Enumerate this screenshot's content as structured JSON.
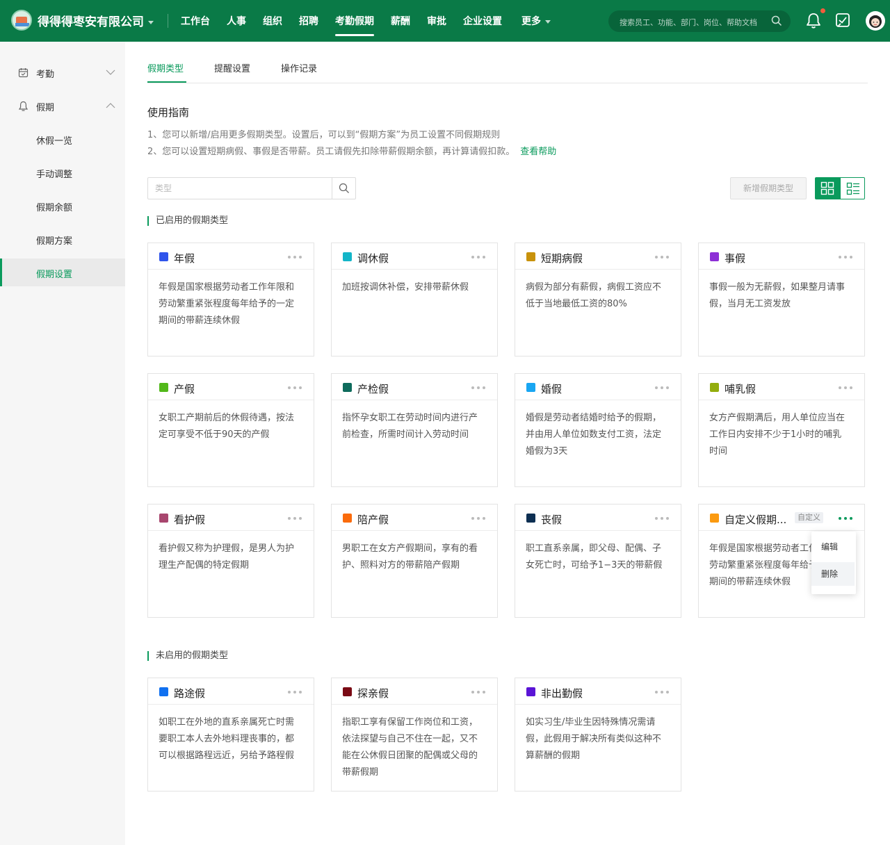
{
  "header": {
    "company": "得得得枣安有限公司",
    "nav": [
      "工作台",
      "人事",
      "组织",
      "招聘",
      "考勤假期",
      "薪酬",
      "审批",
      "企业设置",
      "更多"
    ],
    "active_nav": "考勤假期",
    "search_placeholder": "搜索员工、功能、部门、岗位、帮助文档",
    "notification_dot": true
  },
  "sidebar": {
    "groups": [
      {
        "label": "考勤",
        "icon": "calendar-icon",
        "expanded": false
      },
      {
        "label": "假期",
        "icon": "bell-icon",
        "expanded": true
      }
    ],
    "items": [
      "休假一览",
      "手动调整",
      "假期余额",
      "假期方案",
      "假期设置"
    ],
    "active": "假期设置"
  },
  "tabs": [
    "假期类型",
    "提醒设置",
    "操作记录"
  ],
  "active_tab": "假期类型",
  "guide": {
    "title": "使用指南",
    "line1": "1、您可以新增/启用更多假期类型。设置后，可以到“假期方案”为员工设置不同假期规则",
    "line2": "2、您可以设置短期病假、事假是否带薪。员工请假先扣除带薪假期余额，再计算请假扣款。",
    "help_link": "查看帮助"
  },
  "toolbar": {
    "type_placeholder": "类型",
    "add_button": "新增假期类型"
  },
  "enabled_title": "已启用的假期类型",
  "disabled_title": "未启用的假期类型",
  "enabled_types": [
    {
      "name": "年假",
      "color": "#2f54eb",
      "desc": "年假是国家根据劳动者工作年限和劳动繁重紧张程度每年给予的一定期间的带薪连续休假"
    },
    {
      "name": "调休假",
      "color": "#13b5c8",
      "desc": "加班按调休补偿，安排带薪休假"
    },
    {
      "name": "短期病假",
      "color": "#c8920b",
      "desc": "病假为部分有薪假，病假工资应不低于当地最低工资的80%"
    },
    {
      "name": "事假",
      "color": "#8d2fd6",
      "desc": "事假一般为无薪假，如果整月请事假，当月无工资发放"
    },
    {
      "name": "产假",
      "color": "#52b81a",
      "desc": "女职工产期前后的休假待遇，按法定可享受不低于90天的产假"
    },
    {
      "name": "产检假",
      "color": "#0e6b5c",
      "desc": "指怀孕女职工在劳动时间内进行产前检查，所需时间计入劳动时间"
    },
    {
      "name": "婚假",
      "color": "#19a6f2",
      "desc": "婚假是劳动者结婚时给予的假期，并由用人单位如数支付工资，法定婚假为3天"
    },
    {
      "name": "哺乳假",
      "color": "#93ad0d",
      "desc": "女方产假期满后，用人单位应当在工作日内安排不少于1小时的哺乳时间"
    },
    {
      "name": "看护假",
      "color": "#a8466e",
      "desc": "看护假又称为护理假，是男人为护理生产配偶的特定假期"
    },
    {
      "name": "陪产假",
      "color": "#fa6b0c",
      "desc": "男职工在女方产假期间，享有的看护、照料对方的带薪陪产假期"
    },
    {
      "name": "丧假",
      "color": "#0d2f52",
      "desc": "职工直系亲属，即父母、配偶、子女死亡时，可给予1−3天的带薪假"
    },
    {
      "name": "自定义假期...",
      "color": "#fb9a10",
      "badge": "自定义",
      "desc": "年假是国家根据劳动者工作年限和劳动繁重紧张程度每年给予的一定期间的带薪连续休假"
    }
  ],
  "disabled_types": [
    {
      "name": "路途假",
      "color": "#1070f0",
      "desc": "如职工在外地的直系亲属死亡时需要职工本人去外地料理丧事的，都可以根据路程远近，另给予路程假"
    },
    {
      "name": "探亲假",
      "color": "#7a0a14",
      "desc": "指职工享有保留工作岗位和工资，依法探望与自己不住在一起，又不能在公休假日团聚的配偶或父母的带薪假期"
    },
    {
      "name": "非出勤假",
      "color": "#5a14d6",
      "desc": "如实习生/毕业生因特殊情况需请假，此假用于解决所有类似这种不算薪酬的假期"
    }
  ],
  "dropdown": {
    "items": [
      "编辑",
      "删除"
    ],
    "highlighted": "删除"
  }
}
